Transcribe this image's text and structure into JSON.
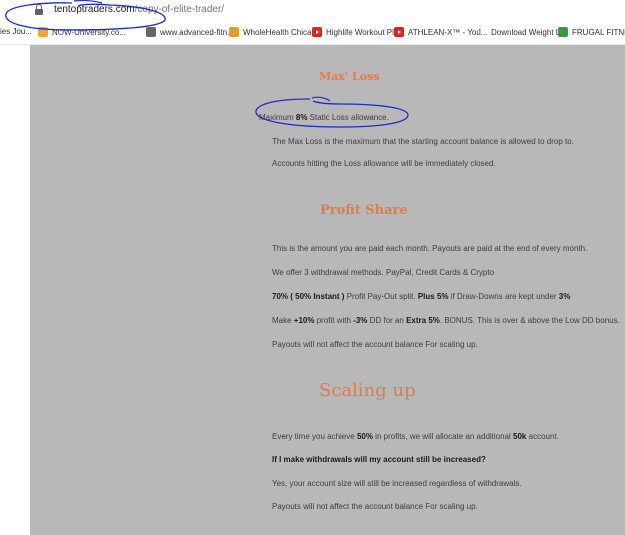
{
  "browser": {
    "url_domain": "tentoptraders.com",
    "url_path": "/copy-of-elite-trader/"
  },
  "bookmarks": [
    {
      "label": "ies Jou...",
      "icon": "bookmark-icon"
    },
    {
      "label": "NOW-University.co...",
      "icon": "now-university-icon"
    },
    {
      "label": "www.advanced-fitn...",
      "icon": "globe-icon"
    },
    {
      "label": "WholeHealth Chica...",
      "icon": "wholehealth-icon"
    },
    {
      "label": "Highlife Workout Pl...",
      "icon": "youtube-icon"
    },
    {
      "label": "ATHLEAN-X™ - You...",
      "icon": "youtube-icon"
    },
    {
      "label": "Download Weight L...",
      "icon": "download-icon"
    },
    {
      "label": "FRUGAL FITNESS ®",
      "icon": "frugal-fitness-icon"
    }
  ],
  "max_loss": {
    "heading": "Max' Loss",
    "line1_pre": "Maximum ",
    "line1_bold": "8%",
    "line1_post": " Static Loss allowance.",
    "line2": "The Max Loss is the maximum that the starting account balance is allowed to drop to.",
    "line3": "Accounts hitting the Loss allowance will be immediately closed."
  },
  "profit_share": {
    "heading": "Profit Share",
    "line1": "This is the amount you are paid each month. Payouts are paid at the end of every month.",
    "line2": "We offer 3 withdrawal methods. PayPal, Credit Cards & Crypto",
    "line3_bold1": "70% ( 50% Instant )",
    "line3_mid1": " Profit Pay-Out split. ",
    "line3_bold2": "Plus 5%",
    "line3_mid2": " if Draw-Downs are kept under ",
    "line3_bold3": "3%",
    "line4_pre": "Make ",
    "line4_bold1": "+10%",
    "line4_mid1": " profit with ",
    "line4_bold2": "-3%",
    "line4_mid2": " DD for an ",
    "line4_bold3": "Extra 5%",
    "line4_post": ". BONUS. This is over & above the Low DD bonus.",
    "line5": "Payouts will not affect the account balance For scaling up."
  },
  "scaling_up": {
    "heading": "Scaling up",
    "line1_pre": "Every time you achieve ",
    "line1_bold1": "50%",
    "line1_mid": " in profits, we will allocate an additional ",
    "line1_bold2": "50k",
    "line1_post": " account.",
    "line2_bold": "If I make withdrawals will my account still be increased?",
    "line3": "Yes, your account size will still be increased regardless of withdrawals.",
    "line4": "Payouts will not affect the account balance For scaling up."
  },
  "colors": {
    "heading": "#e07b4a",
    "content_bg": "#b8b8b8",
    "annotation_ink": "#1b2bd0"
  }
}
